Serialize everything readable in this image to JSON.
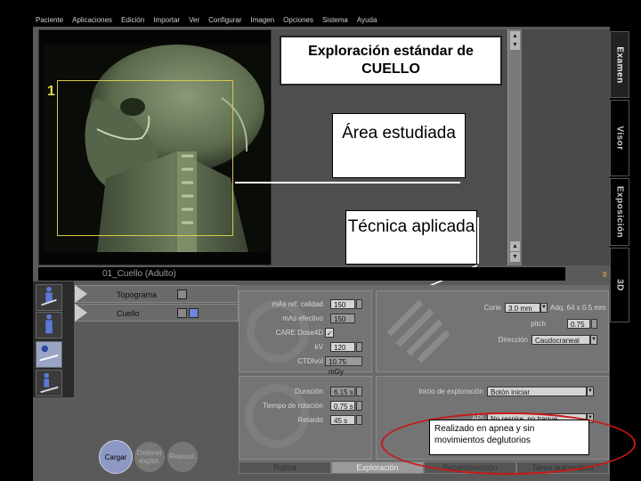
{
  "menu": [
    "Paciente",
    "Aplicaciones",
    "Edición",
    "Importar",
    "Ver",
    "Configurar",
    "Imagen",
    "Opciones",
    "Sistema",
    "Ayuda"
  ],
  "side_tabs": {
    "examen": "Examen",
    "visor": "Visor",
    "exposicion": "Exposición",
    "3d": "3D"
  },
  "callouts": {
    "title": "Exploración estándar de CUELLO",
    "area": "Área estudiada",
    "tecnica": "Técnica aplicada",
    "note": "Realizado en apnea y sin movimientos deglutorios"
  },
  "roi_number": "1",
  "scan": {
    "name": "01_Cuello (Adulto)",
    "count": "0"
  },
  "series": [
    {
      "label": "Topograma"
    },
    {
      "label": "Cuello"
    }
  ],
  "params": {
    "ref_quality_label": "mAs ref. calidad",
    "ref_quality_value": "150",
    "mas_eff_label": "mAs efectivo",
    "mas_eff_value": "150",
    "caredose_label": "CARE Dose4D",
    "kv_label": "kV",
    "kv_value": "120",
    "ctdi_label": "CTDIvol",
    "ctdi_value": "10.75 mGy",
    "corte_label": "Corte",
    "corte_value": "3.0 mm",
    "adq_label": "Adq. 64 x 0.5 mm",
    "pitch_label": "pitch",
    "pitch_value": "0.75",
    "direccion_label": "Dirección",
    "direccion_value": "Caudocraneal",
    "duracion_label": "Duración",
    "duracion_value": "6.15 s",
    "rotacion_label": "Tiempo de rotación",
    "rotacion_value": "0.75 s",
    "retardo_label": "Retardo",
    "retardo_value": "45 s",
    "inicio_label": "Inicio de exploración",
    "inicio_value": "Botón iniciar",
    "api_label": "API",
    "api_value": "No respire, no trague"
  },
  "buttons": {
    "cargar": "Cargar",
    "detener": "Detener explor.",
    "reanudar": "Reanud."
  },
  "bottom_tabs": [
    "Rutina",
    "Exploración",
    "Reconstrucción",
    "Tarea automática"
  ],
  "colors": {
    "roi": "#d8c84a",
    "note_ellipse": "#c81818",
    "cargar": "#8e98c4"
  }
}
